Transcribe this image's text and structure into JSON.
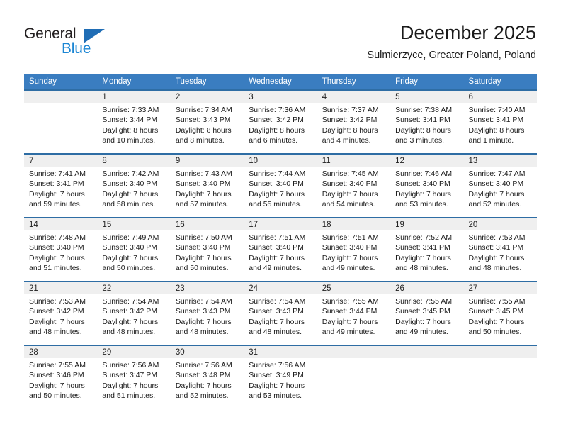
{
  "brand": {
    "name_top": "General",
    "name_bottom": "Blue",
    "accent_color": "#1b86d4",
    "triangle_color": "#1f6db5"
  },
  "header": {
    "title": "December 2025",
    "subtitle": "Sulmierzyce, Greater Poland, Poland"
  },
  "theme": {
    "header_row_bg": "#3a7dc0",
    "week_divider": "#2e6da4",
    "daynum_band_bg": "#efefef"
  },
  "weekdays": [
    "Sunday",
    "Monday",
    "Tuesday",
    "Wednesday",
    "Thursday",
    "Friday",
    "Saturday"
  ],
  "labels": {
    "sunrise": "Sunrise:",
    "sunset": "Sunset:",
    "daylight": "Daylight:"
  },
  "weeks": [
    [
      {
        "day": "",
        "sunrise": "",
        "sunset": "",
        "daylight_1": "",
        "daylight_2": ""
      },
      {
        "day": "1",
        "sunrise": "Sunrise: 7:33 AM",
        "sunset": "Sunset: 3:44 PM",
        "daylight_1": "Daylight: 8 hours",
        "daylight_2": "and 10 minutes."
      },
      {
        "day": "2",
        "sunrise": "Sunrise: 7:34 AM",
        "sunset": "Sunset: 3:43 PM",
        "daylight_1": "Daylight: 8 hours",
        "daylight_2": "and 8 minutes."
      },
      {
        "day": "3",
        "sunrise": "Sunrise: 7:36 AM",
        "sunset": "Sunset: 3:42 PM",
        "daylight_1": "Daylight: 8 hours",
        "daylight_2": "and 6 minutes."
      },
      {
        "day": "4",
        "sunrise": "Sunrise: 7:37 AM",
        "sunset": "Sunset: 3:42 PM",
        "daylight_1": "Daylight: 8 hours",
        "daylight_2": "and 4 minutes."
      },
      {
        "day": "5",
        "sunrise": "Sunrise: 7:38 AM",
        "sunset": "Sunset: 3:41 PM",
        "daylight_1": "Daylight: 8 hours",
        "daylight_2": "and 3 minutes."
      },
      {
        "day": "6",
        "sunrise": "Sunrise: 7:40 AM",
        "sunset": "Sunset: 3:41 PM",
        "daylight_1": "Daylight: 8 hours",
        "daylight_2": "and 1 minute."
      }
    ],
    [
      {
        "day": "7",
        "sunrise": "Sunrise: 7:41 AM",
        "sunset": "Sunset: 3:41 PM",
        "daylight_1": "Daylight: 7 hours",
        "daylight_2": "and 59 minutes."
      },
      {
        "day": "8",
        "sunrise": "Sunrise: 7:42 AM",
        "sunset": "Sunset: 3:40 PM",
        "daylight_1": "Daylight: 7 hours",
        "daylight_2": "and 58 minutes."
      },
      {
        "day": "9",
        "sunrise": "Sunrise: 7:43 AM",
        "sunset": "Sunset: 3:40 PM",
        "daylight_1": "Daylight: 7 hours",
        "daylight_2": "and 57 minutes."
      },
      {
        "day": "10",
        "sunrise": "Sunrise: 7:44 AM",
        "sunset": "Sunset: 3:40 PM",
        "daylight_1": "Daylight: 7 hours",
        "daylight_2": "and 55 minutes."
      },
      {
        "day": "11",
        "sunrise": "Sunrise: 7:45 AM",
        "sunset": "Sunset: 3:40 PM",
        "daylight_1": "Daylight: 7 hours",
        "daylight_2": "and 54 minutes."
      },
      {
        "day": "12",
        "sunrise": "Sunrise: 7:46 AM",
        "sunset": "Sunset: 3:40 PM",
        "daylight_1": "Daylight: 7 hours",
        "daylight_2": "and 53 minutes."
      },
      {
        "day": "13",
        "sunrise": "Sunrise: 7:47 AM",
        "sunset": "Sunset: 3:40 PM",
        "daylight_1": "Daylight: 7 hours",
        "daylight_2": "and 52 minutes."
      }
    ],
    [
      {
        "day": "14",
        "sunrise": "Sunrise: 7:48 AM",
        "sunset": "Sunset: 3:40 PM",
        "daylight_1": "Daylight: 7 hours",
        "daylight_2": "and 51 minutes."
      },
      {
        "day": "15",
        "sunrise": "Sunrise: 7:49 AM",
        "sunset": "Sunset: 3:40 PM",
        "daylight_1": "Daylight: 7 hours",
        "daylight_2": "and 50 minutes."
      },
      {
        "day": "16",
        "sunrise": "Sunrise: 7:50 AM",
        "sunset": "Sunset: 3:40 PM",
        "daylight_1": "Daylight: 7 hours",
        "daylight_2": "and 50 minutes."
      },
      {
        "day": "17",
        "sunrise": "Sunrise: 7:51 AM",
        "sunset": "Sunset: 3:40 PM",
        "daylight_1": "Daylight: 7 hours",
        "daylight_2": "and 49 minutes."
      },
      {
        "day": "18",
        "sunrise": "Sunrise: 7:51 AM",
        "sunset": "Sunset: 3:40 PM",
        "daylight_1": "Daylight: 7 hours",
        "daylight_2": "and 49 minutes."
      },
      {
        "day": "19",
        "sunrise": "Sunrise: 7:52 AM",
        "sunset": "Sunset: 3:41 PM",
        "daylight_1": "Daylight: 7 hours",
        "daylight_2": "and 48 minutes."
      },
      {
        "day": "20",
        "sunrise": "Sunrise: 7:53 AM",
        "sunset": "Sunset: 3:41 PM",
        "daylight_1": "Daylight: 7 hours",
        "daylight_2": "and 48 minutes."
      }
    ],
    [
      {
        "day": "21",
        "sunrise": "Sunrise: 7:53 AM",
        "sunset": "Sunset: 3:42 PM",
        "daylight_1": "Daylight: 7 hours",
        "daylight_2": "and 48 minutes."
      },
      {
        "day": "22",
        "sunrise": "Sunrise: 7:54 AM",
        "sunset": "Sunset: 3:42 PM",
        "daylight_1": "Daylight: 7 hours",
        "daylight_2": "and 48 minutes."
      },
      {
        "day": "23",
        "sunrise": "Sunrise: 7:54 AM",
        "sunset": "Sunset: 3:43 PM",
        "daylight_1": "Daylight: 7 hours",
        "daylight_2": "and 48 minutes."
      },
      {
        "day": "24",
        "sunrise": "Sunrise: 7:54 AM",
        "sunset": "Sunset: 3:43 PM",
        "daylight_1": "Daylight: 7 hours",
        "daylight_2": "and 48 minutes."
      },
      {
        "day": "25",
        "sunrise": "Sunrise: 7:55 AM",
        "sunset": "Sunset: 3:44 PM",
        "daylight_1": "Daylight: 7 hours",
        "daylight_2": "and 49 minutes."
      },
      {
        "day": "26",
        "sunrise": "Sunrise: 7:55 AM",
        "sunset": "Sunset: 3:45 PM",
        "daylight_1": "Daylight: 7 hours",
        "daylight_2": "and 49 minutes."
      },
      {
        "day": "27",
        "sunrise": "Sunrise: 7:55 AM",
        "sunset": "Sunset: 3:45 PM",
        "daylight_1": "Daylight: 7 hours",
        "daylight_2": "and 50 minutes."
      }
    ],
    [
      {
        "day": "28",
        "sunrise": "Sunrise: 7:55 AM",
        "sunset": "Sunset: 3:46 PM",
        "daylight_1": "Daylight: 7 hours",
        "daylight_2": "and 50 minutes."
      },
      {
        "day": "29",
        "sunrise": "Sunrise: 7:56 AM",
        "sunset": "Sunset: 3:47 PM",
        "daylight_1": "Daylight: 7 hours",
        "daylight_2": "and 51 minutes."
      },
      {
        "day": "30",
        "sunrise": "Sunrise: 7:56 AM",
        "sunset": "Sunset: 3:48 PM",
        "daylight_1": "Daylight: 7 hours",
        "daylight_2": "and 52 minutes."
      },
      {
        "day": "31",
        "sunrise": "Sunrise: 7:56 AM",
        "sunset": "Sunset: 3:49 PM",
        "daylight_1": "Daylight: 7 hours",
        "daylight_2": "and 53 minutes."
      },
      {
        "day": "",
        "sunrise": "",
        "sunset": "",
        "daylight_1": "",
        "daylight_2": ""
      },
      {
        "day": "",
        "sunrise": "",
        "sunset": "",
        "daylight_1": "",
        "daylight_2": ""
      },
      {
        "day": "",
        "sunrise": "",
        "sunset": "",
        "daylight_1": "",
        "daylight_2": ""
      }
    ]
  ]
}
